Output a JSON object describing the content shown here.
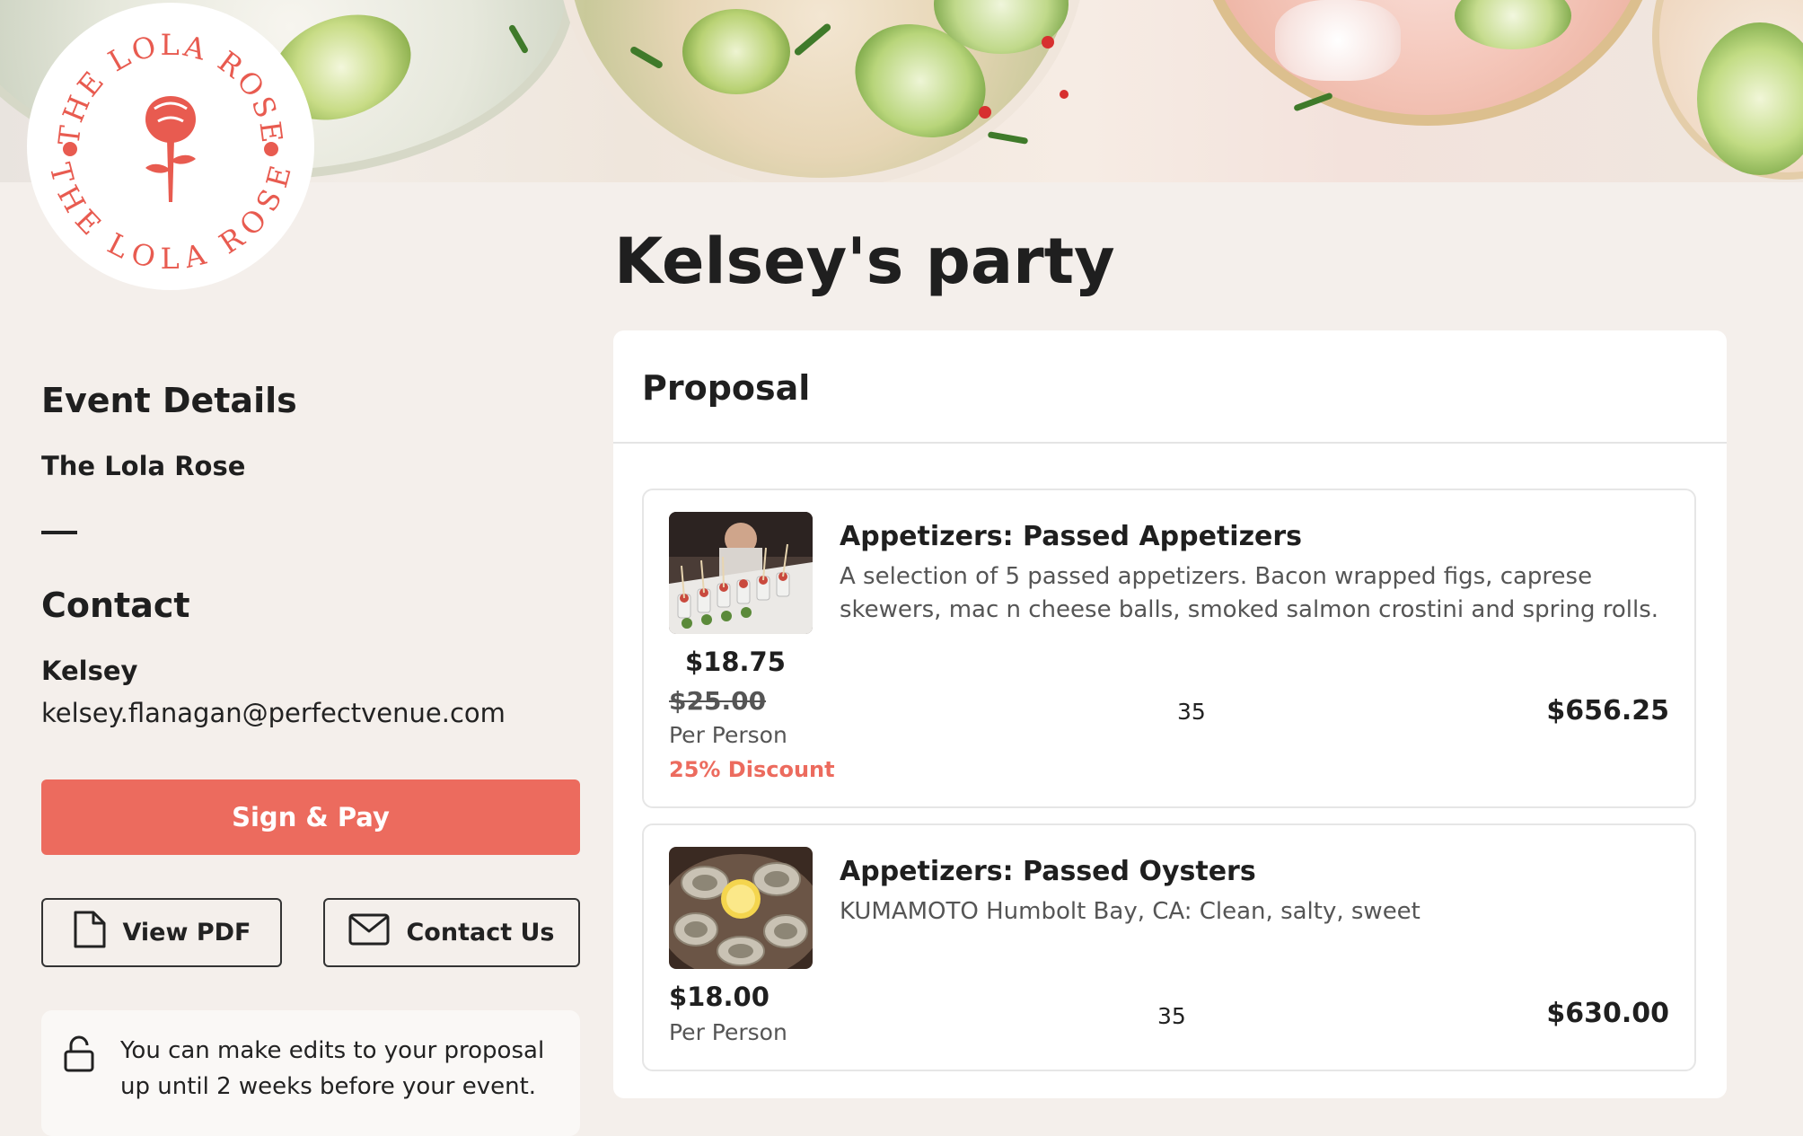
{
  "logo": {
    "top_text": "THE LOLA ROSE",
    "bottom_text": "THE LOLA ROSE",
    "accent_color": "#e85b50"
  },
  "page": {
    "title": "Kelsey's party"
  },
  "sidebar": {
    "event_details_heading": "Event Details",
    "venue_name": "The Lola Rose",
    "contact_heading": "Contact",
    "contact_name": "Kelsey",
    "contact_email": "kelsey.flanagan@perfectvenue.com",
    "sign_pay_label": "Sign & Pay",
    "view_pdf_label": "View PDF",
    "contact_us_label": "Contact Us",
    "notice_text": "You can make edits to your proposal up until 2 weeks before your event."
  },
  "proposal": {
    "title": "Proposal",
    "items": [
      {
        "name": "Appetizers: Passed Appetizers",
        "description": "A selection of 5 passed appetizers. Bacon wrapped figs, caprese skewers, mac n cheese balls, smoked salmon crostini and spring rolls.",
        "price": "$18.75",
        "original_price": "$25.00",
        "unit": "Per Person",
        "discount": "25% Discount",
        "quantity": "35",
        "total": "$656.25",
        "image_icon": "appetizer-photo-icon"
      },
      {
        "name": "Appetizers: Passed Oysters",
        "description": "KUMAMOTO Humbolt Bay, CA: Clean, salty, sweet",
        "price": "$18.00",
        "unit": "Per Person",
        "quantity": "35",
        "total": "$630.00",
        "image_icon": "oysters-photo-icon"
      }
    ]
  },
  "colors": {
    "background": "#f4efeb",
    "accent": "#ec6b5e",
    "card": "#ffffff"
  }
}
